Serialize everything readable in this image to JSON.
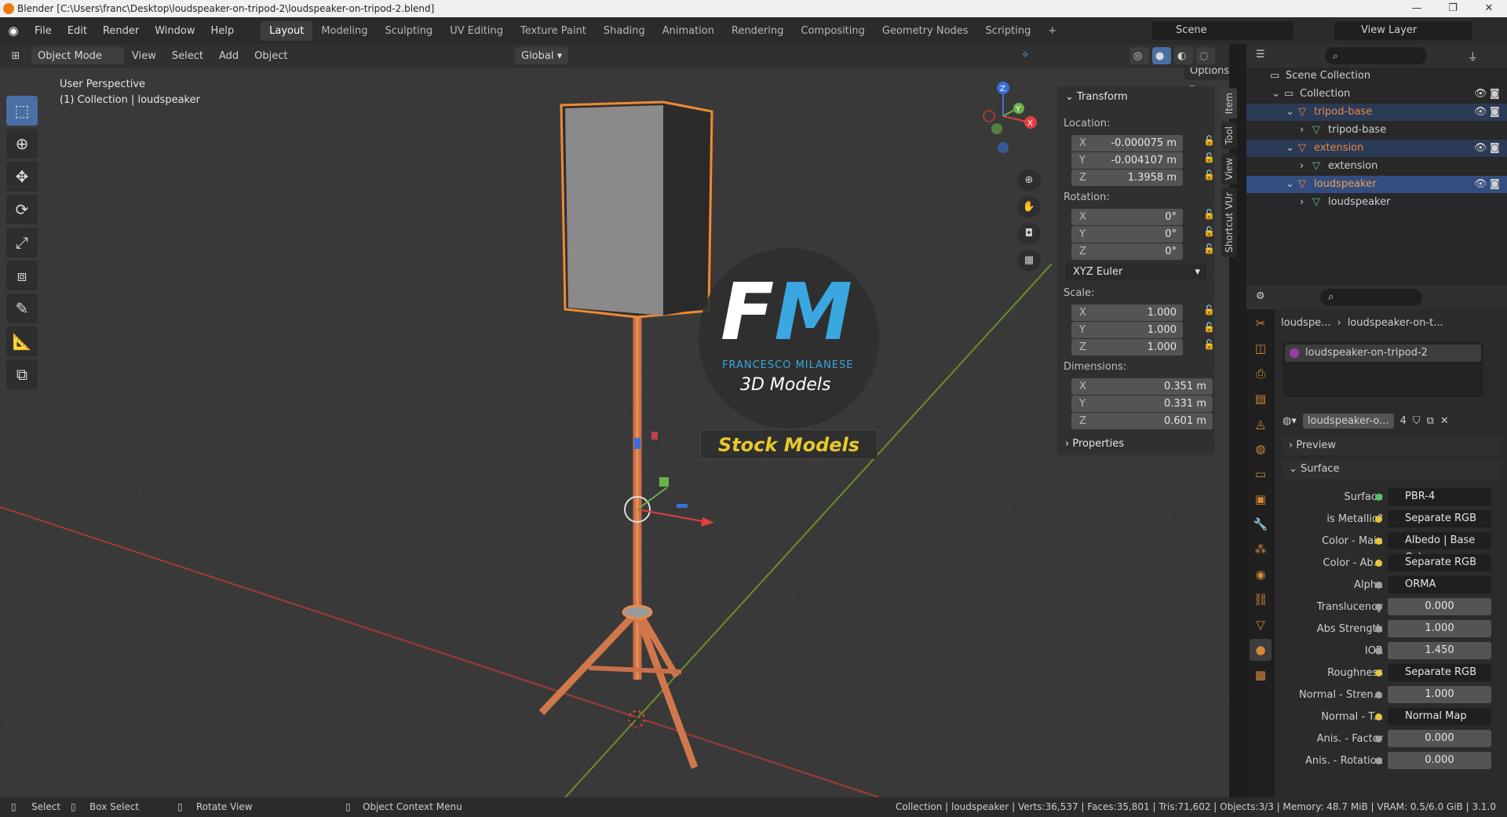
{
  "window": {
    "title": "Blender [C:\\Users\\franc\\Desktop\\loudspeaker-on-tripod-2\\loudspeaker-on-tripod-2.blend]",
    "min": "—",
    "max": "❐",
    "close": "✕"
  },
  "menu": [
    "File",
    "Edit",
    "Render",
    "Window",
    "Help"
  ],
  "workspaces": [
    "Layout",
    "Modeling",
    "Sculpting",
    "UV Editing",
    "Texture Paint",
    "Shading",
    "Animation",
    "Rendering",
    "Compositing",
    "Geometry Nodes",
    "Scripting"
  ],
  "workspace_add": "+",
  "scene": "Scene",
  "view_layer": "View Layer",
  "viewport_header": {
    "mode": "Object Mode",
    "menus": [
      "View",
      "Select",
      "Add",
      "Object"
    ],
    "orientation": "Global",
    "options": "Options"
  },
  "viewport": {
    "perspective": "User Perspective",
    "collection_label": "(1) Collection | loudspeaker",
    "watermark_initials_f": "F",
    "watermark_initials_m": "M",
    "watermark_name": "FRANCESCO MILANESE",
    "watermark_sub": "3D Models",
    "watermark_banner": "Stock Models",
    "gizmo_axes": [
      "X",
      "Y",
      "Z"
    ]
  },
  "sidebar_tabs": [
    "Item",
    "Tool",
    "View",
    "Shortcut VUr"
  ],
  "transform": {
    "title": "Transform",
    "location_label": "Location:",
    "location": [
      {
        "axis": "X",
        "value": "-0.000075 m"
      },
      {
        "axis": "Y",
        "value": "-0.004107 m"
      },
      {
        "axis": "Z",
        "value": "1.3958 m"
      }
    ],
    "rotation_label": "Rotation:",
    "rotation": [
      {
        "axis": "X",
        "value": "0°"
      },
      {
        "axis": "Y",
        "value": "0°"
      },
      {
        "axis": "Z",
        "value": "0°"
      }
    ],
    "rotation_mode": "XYZ Euler",
    "scale_label": "Scale:",
    "scale": [
      {
        "axis": "X",
        "value": "1.000"
      },
      {
        "axis": "Y",
        "value": "1.000"
      },
      {
        "axis": "Z",
        "value": "1.000"
      }
    ],
    "dimensions_label": "Dimensions:",
    "dimensions": [
      {
        "axis": "X",
        "value": "0.351 m"
      },
      {
        "axis": "Y",
        "value": "0.331 m"
      },
      {
        "axis": "Z",
        "value": "0.601 m"
      }
    ],
    "properties": "Properties"
  },
  "outliner": {
    "rows": [
      {
        "label": "Scene Collection",
        "indent": 0,
        "color": "#cfcfcf"
      },
      {
        "label": "Collection",
        "indent": 1,
        "color": "#cfcfcf"
      },
      {
        "label": "tripod-base",
        "indent": 2,
        "color": "#e8884a"
      },
      {
        "label": "tripod-base",
        "indent": 3,
        "color": "#cfcfcf"
      },
      {
        "label": "extension",
        "indent": 2,
        "color": "#e8884a"
      },
      {
        "label": "extension",
        "indent": 3,
        "color": "#cfcfcf"
      },
      {
        "label": "loudspeaker",
        "indent": 2,
        "color": "#f0a050"
      },
      {
        "label": "loudspeaker",
        "indent": 3,
        "color": "#cfcfcf"
      }
    ]
  },
  "properties": {
    "breadcrumb_obj": "loudspe...",
    "breadcrumb_sep": "›",
    "breadcrumb_mat": "loudspeaker-on-t...",
    "slot": "loudspeaker-on-tripod-2",
    "material_name": "loudspeaker-o...",
    "users": "4",
    "preview": "Preview",
    "surface_section": "Surface",
    "rows": [
      {
        "label": "Surface",
        "value": "PBR-4",
        "dot": "#4fc26e",
        "kind": "link"
      },
      {
        "label": "is Metallic?",
        "value": "Separate RGB",
        "dot": "#e6c440",
        "kind": "link"
      },
      {
        "label": "Color - Main",
        "value": "Albedo | Base Color",
        "dot": "#e6c440",
        "kind": "link"
      },
      {
        "label": "Color - Ab...",
        "value": "Separate RGB",
        "dot": "#e6c440",
        "kind": "link"
      },
      {
        "label": "Alpha",
        "value": "ORMA",
        "dot": "#a0a0a0",
        "kind": "link"
      },
      {
        "label": "Translucency",
        "value": "0.000",
        "dot": "#a0a0a0",
        "kind": "num"
      },
      {
        "label": "Abs Strength",
        "value": "1.000",
        "dot": "#a0a0a0",
        "kind": "num"
      },
      {
        "label": "IOR",
        "value": "1.450",
        "dot": "#a0a0a0",
        "kind": "num"
      },
      {
        "label": "Roughness",
        "value": "Separate RGB",
        "dot": "#e6c440",
        "kind": "link"
      },
      {
        "label": "Normal - Stren...",
        "value": "1.000",
        "dot": "#a0a0a0",
        "kind": "num"
      },
      {
        "label": "Normal - T...",
        "value": "Normal Map",
        "dot": "#e6c440",
        "kind": "link"
      },
      {
        "label": "Anis. - Factor",
        "value": "0.000",
        "dot": "#a0a0a0",
        "kind": "num"
      },
      {
        "label": "Anis. - Rotation",
        "value": "0.000",
        "dot": "#a0a0a0",
        "kind": "num"
      }
    ]
  },
  "status": {
    "select": "Select",
    "box_select": "Box Select",
    "rotate": "Rotate View",
    "context": "Object Context Menu",
    "stats": "Collection | loudspeaker | Verts:36,537 | Faces:35,801 | Tris:71,602 | Objects:3/3 | Memory: 48.7 MiB | VRAM: 0.5/6.0 GiB | 3.1.0"
  }
}
